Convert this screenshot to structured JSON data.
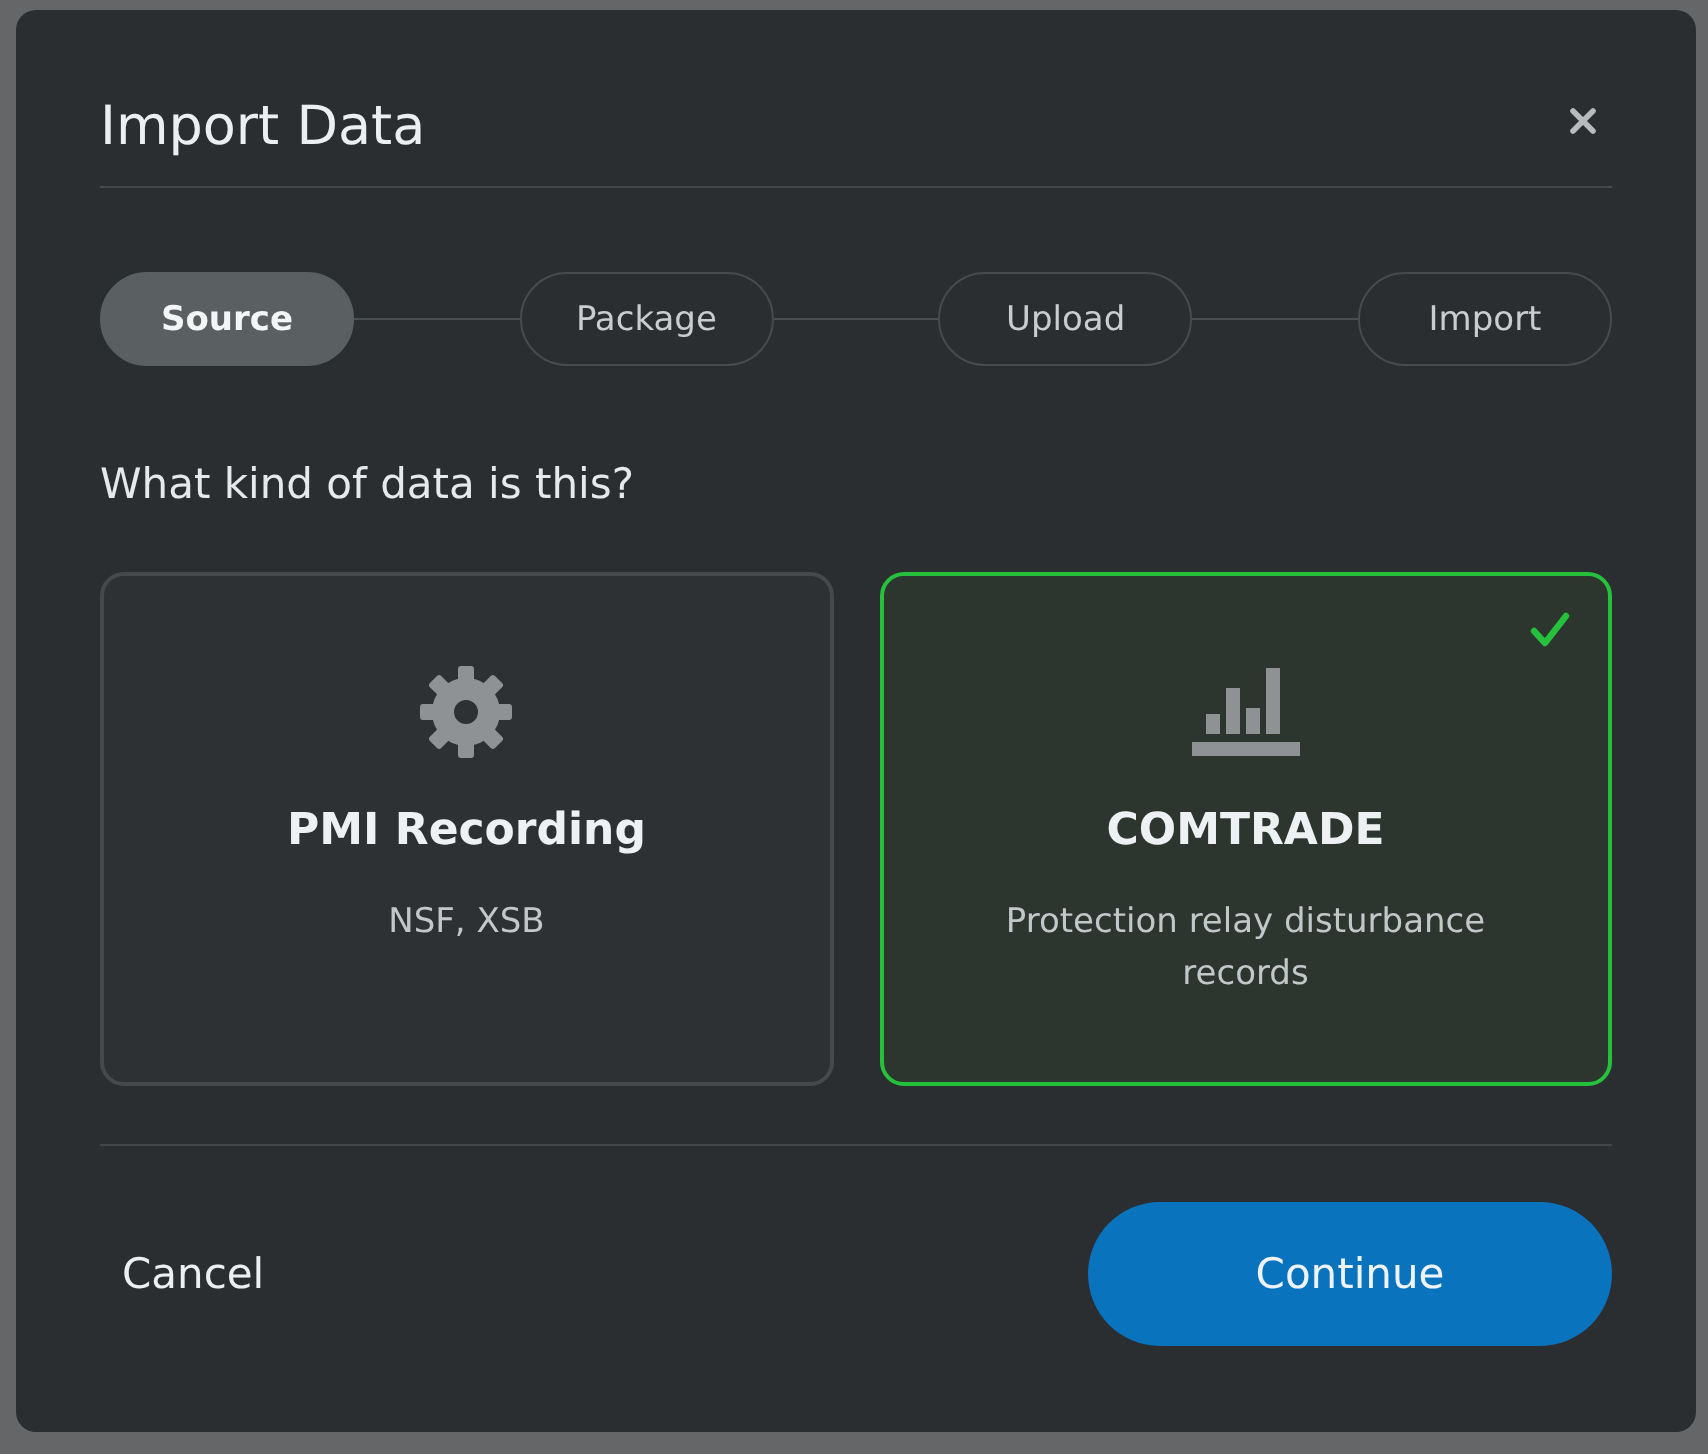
{
  "dialog": {
    "title": "Import Data"
  },
  "steps": [
    {
      "label": "Source",
      "selected": true
    },
    {
      "label": "Package",
      "selected": false
    },
    {
      "label": "Upload",
      "selected": false
    },
    {
      "label": "Import",
      "selected": false
    }
  ],
  "question": "What kind of data is this?",
  "options": [
    {
      "kind": "gear",
      "title": "PMI Recording",
      "description": "NSF, XSB",
      "selected": false
    },
    {
      "kind": "chart",
      "title": "COMTRADE",
      "description": "Protection relay disturbance records",
      "selected": true
    }
  ],
  "buttons": [
    {
      "kind": "text",
      "label": "Cancel"
    },
    {
      "kind": "primary",
      "label": "Continue"
    }
  ]
}
